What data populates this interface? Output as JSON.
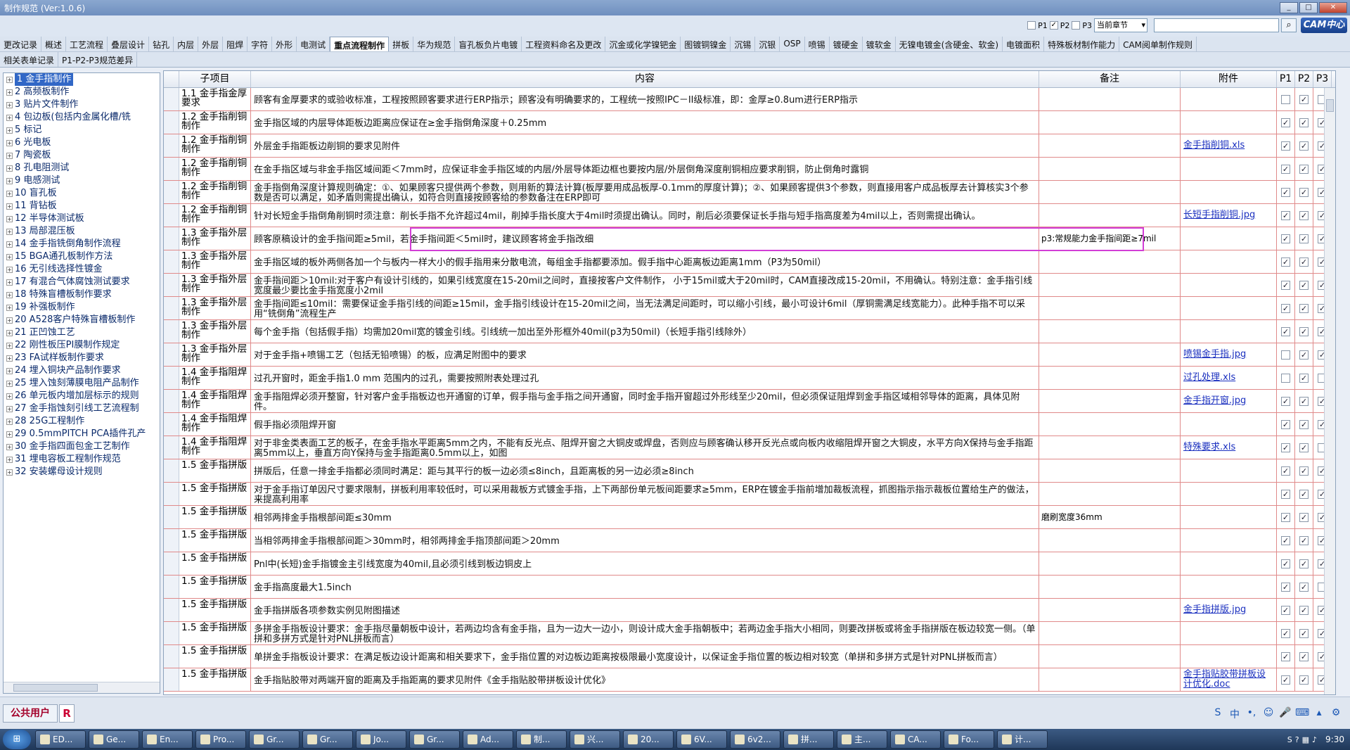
{
  "window": {
    "title": "制作规范 (Ver:1.0.6)"
  },
  "toolbar": {
    "filters": [
      {
        "label": "P1",
        "checked": false
      },
      {
        "label": "P2",
        "checked": true
      },
      {
        "label": "P3",
        "checked": false
      }
    ],
    "chapter_select": "当前章节",
    "logo": "CAM中心"
  },
  "tabs_row1": [
    "更改记录",
    "概述",
    "工艺流程",
    "叠层设计",
    "钻孔",
    "内层",
    "外层",
    "阻焊",
    "字符",
    "外形",
    "电测试",
    "重点流程制作",
    "拼板",
    "华为规范",
    "盲孔板负片电镀",
    "工程资料命名及更改",
    "沉金或化学镍钯金",
    "图镀铜镍金",
    "沉锡",
    "沉银",
    "OSP",
    "喷锡",
    "镀硬金",
    "镀软金",
    "无镍电镀金(含硬金、软金)",
    "电镀面积",
    "特殊板材制作能力",
    "CAM阅单制作规则"
  ],
  "tabs_row2": [
    "相关表单记录",
    "P1-P2-P3规范差异"
  ],
  "active_tab_index": 11,
  "tree": [
    "1 金手指制作",
    "2 高频板制作",
    "3 贴片文件制作",
    "4 包边板(包括内金属化槽/铣",
    "5 标记",
    "6 光电板",
    "7 陶瓷板",
    "8 孔电阻测试",
    "9 电感测试",
    "10 盲孔板",
    "11 背钻板",
    "12 半导体测试板",
    "13 局部混压板",
    "14 金手指铣倒角制作流程",
    "15 BGA通孔板制作方法",
    "16 无引线选择性镀金",
    "17 有混合气体腐蚀测试要求",
    "18 特殊盲槽板制作要求",
    "19 补强板制作",
    "20 A528客户特殊盲槽板制作",
    "21 正凹蚀工艺",
    "22 刚性板压PI膜制作规定",
    "23 FA试样板制作要求",
    "24 埋入铜块产品制作要求",
    "25 埋入蚀刻薄膜电阻产品制作",
    "26 单元板内增加层标示的规则",
    "27 金手指蚀刻引线工艺流程制",
    "28 25G工程制作",
    "29 0.5mmPITCH PCA插件孔产",
    "30 金手指四面包金工艺制作",
    "31 埋电容板工程制作规范",
    "32 安装螺母设计规则"
  ],
  "grid": {
    "headers": {
      "sub": "子项目",
      "content": "内容",
      "note": "备注",
      "attachment": "附件",
      "p1": "P1",
      "p2": "P2",
      "p3": "P3"
    },
    "rows": [
      {
        "sub": "1.1 金手指金厚要求",
        "content": "顾客有金厚要求的或验收标准，工程按照顾客要求进行ERP指示；顾客没有明确要求的，工程统一按照IPC－II级标准，即：金厚≥0.8um进行ERP指示",
        "note": "",
        "att": "",
        "p": [
          false,
          true,
          false
        ]
      },
      {
        "sub": "1.2 金手指削铜制作",
        "content": "金手指区域的内层导体距板边距离应保证在≥金手指倒角深度＋0.25mm",
        "note": "",
        "att": "",
        "p": [
          true,
          true,
          true
        ]
      },
      {
        "sub": "1.2 金手指削铜制作",
        "content": "外层金手指距板边削铜的要求见附件",
        "note": "",
        "att": "金手指削铜.xls",
        "p": [
          true,
          true,
          true
        ]
      },
      {
        "sub": "1.2 金手指削铜制作",
        "content": "在金手指区域与非金手指区域间距＜7mm时，应保证非金手指区域的内层/外层导体距边框也要按内层/外层倒角深度削铜相应要求削铜，防止倒角时露铜",
        "note": "",
        "att": "",
        "p": [
          true,
          true,
          true
        ]
      },
      {
        "sub": "1.2 金手指削铜制作",
        "content": "金手指倒角深度计算规则确定：①、如果顾客只提供两个参数，则用新的算法计算(板厚要用成品板厚-0.1mm的厚度计算)；②、如果顾客提供3个参数，则直接用客户成品板厚去计算核实3个参数是否可以满足，如矛盾则需提出确认，如符合则直接按顾客给的参数备注在ERP即可",
        "note": "",
        "att": "",
        "p": [
          true,
          true,
          true
        ]
      },
      {
        "sub": "1.2 金手指削铜制作",
        "content": "针对长短金手指倒角削铜时须注意：削长手指不允许超过4mil，削掉手指长度大于4mil时须提出确认。同时，削后必须要保证长手指与短手指高度差为4mil以上，否则需提出确认。",
        "note": "",
        "att": "长短手指削铜.jpg",
        "p": [
          true,
          true,
          true
        ]
      },
      {
        "sub": "1.3 金手指外层制作",
        "content": "顾客原稿设计的金手指间距≥5mil，若金手指间距＜5mil时，建议顾客将金手指改细",
        "note": "p3:常规能力金手指间距≥7mil",
        "att": "",
        "p": [
          true,
          true,
          true
        ]
      },
      {
        "sub": "1.3 金手指外层制作",
        "content": "金手指区域的板外两侧各加一个与板内一样大小的假手指用来分散电流，每组金手指都要添加。假手指中心距离板边距离1mm（P3为50mil）",
        "note": "",
        "att": "",
        "p": [
          true,
          true,
          true
        ]
      },
      {
        "sub": "1.3 金手指外层制作",
        "content": "金手指间距＞10mil:对于客户有设计引线的，如果引线宽度在15-20mil之间时，直接按客户文件制作， 小于15mil或大于20mil时，CAM直接改成15-20mil，不用确认。特别注意：金手指引线宽度最少要比金手指宽度小2mil",
        "note": "",
        "att": "",
        "p": [
          true,
          true,
          true
        ]
      },
      {
        "sub": "1.3 金手指外层制作",
        "content": "金手指间距≤10mil：需要保证金手指引线的间距≥15mil，金手指引线设计在15-20mil之间，当无法满足间距时，可以缩小引线，最小可设计6mil（厚铜需满足线宽能力）。此种手指不可以采用“铣倒角”流程生产",
        "note": "",
        "att": "",
        "p": [
          true,
          true,
          true
        ]
      },
      {
        "sub": "1.3 金手指外层制作",
        "content": "每个金手指（包括假手指）均需加20mil宽的镀金引线。引线统一加出至外形框外40mil(p3为50mil)（长短手指引线除外）",
        "note": "",
        "att": "",
        "p": [
          true,
          true,
          true
        ]
      },
      {
        "sub": "1.3 金手指外层制作",
        "content": "对于金手指+喷锡工艺（包括无铅喷锡）的板，应满足附图中的要求",
        "note": "",
        "att": "喷锡金手指.jpg",
        "p": [
          false,
          true,
          true
        ]
      },
      {
        "sub": "1.4 金手指阻焊制作",
        "content": "过孔开窗时，距金手指1.0 mm 范围内的过孔，需要按照附表处理过孔",
        "note": "",
        "att": "过孔处理.xls",
        "p": [
          false,
          true,
          false
        ]
      },
      {
        "sub": "1.4 金手指阻焊制作",
        "content": "金手指阻焊必须开整窗，针对客户金手指板边也开通窗的订单，假手指与金手指之间开通窗，同时金手指开窗超过外形线至少20mil，但必须保证阻焊到金手指区域相邻导体的距离，具体见附件。",
        "note": "",
        "att": "金手指开窗.jpg",
        "p": [
          true,
          true,
          true
        ]
      },
      {
        "sub": "1.4 金手指阻焊制作",
        "content": "假手指必须阻焊开窗",
        "note": "",
        "att": "",
        "p": [
          true,
          true,
          true
        ]
      },
      {
        "sub": "1.4 金手指阻焊制作",
        "content": "对于非金类表面工艺的板子，在金手指水平距离5mm之内，不能有反光点、阻焊开窗之大铜皮或焊盘，否则应与顾客确认移开反光点或向板内收缩阻焊开窗之大铜皮，水平方向X保持与金手指距离5mm以上，垂直方向Y保持与金手指距离0.5mm以上，如图",
        "note": "",
        "att": "特殊要求.xls",
        "p": [
          true,
          true,
          false
        ]
      },
      {
        "sub": "1.5 金手指拼版",
        "content": "拼版后，任意一排金手指都必须同时满足：距与其平行的板一边必须≤8inch，且距离板的另一边必须≥8inch",
        "note": "",
        "att": "",
        "p": [
          true,
          true,
          true
        ]
      },
      {
        "sub": "1.5 金手指拼版",
        "content": "对于金手指订单因尺寸要求限制，拼板利用率较低时，可以采用裁板方式镀金手指，上下两部份单元板间距要求≥5mm，ERP在镀金手指前增加裁板流程，抓图指示指示裁板位置给生产的做法，来提高利用率",
        "note": "",
        "att": "",
        "p": [
          true,
          true,
          true
        ]
      },
      {
        "sub": "1.5 金手指拼版",
        "content": "相邻两排金手指根部间距≤30mm",
        "note": "磨刷宽度36mm",
        "att": "",
        "p": [
          true,
          true,
          true
        ]
      },
      {
        "sub": "1.5 金手指拼版",
        "content": "当相邻两排金手指根部间距＞30mm时，相邻两排金手指顶部间距＞20mm",
        "note": "",
        "att": "",
        "p": [
          true,
          true,
          true
        ]
      },
      {
        "sub": "1.5 金手指拼版",
        "content": "Pnl中(长短)金手指镀金主引线宽度为40mil,且必须引线到板边铜皮上",
        "note": "",
        "att": "",
        "p": [
          true,
          true,
          true
        ]
      },
      {
        "sub": "1.5 金手指拼版",
        "content": "金手指高度最大1.5inch",
        "note": "",
        "att": "",
        "p": [
          true,
          true,
          false
        ]
      },
      {
        "sub": "1.5 金手指拼版",
        "content": "金手指拼版各项参数实例见附图描述",
        "note": "",
        "att": "金手指拼版.jpg",
        "p": [
          true,
          true,
          true
        ]
      },
      {
        "sub": "1.5 金手指拼版",
        "content": "多拼金手指板设计要求：金手指尽量朝板中设计，若两边均含有金手指，且为一边大一边小，则设计成大金手指朝板中；若两边金手指大小相同，则要改拼板或将金手指拼版在板边较宽一侧。（单拼和多拼方式是针对PNL拼板而言）",
        "note": "",
        "att": "",
        "p": [
          true,
          true,
          true
        ]
      },
      {
        "sub": "1.5 金手指拼版",
        "content": "单拼金手指板设计要求：在满足板边设计距离和相关要求下，金手指位置的对边板边距离按极限最小宽度设计，以保证金手指位置的板边相对较宽（单拼和多拼方式是针对PNL拼板而言）",
        "note": "",
        "att": "",
        "p": [
          true,
          true,
          true
        ]
      },
      {
        "sub": "1.5 金手指拼版",
        "content": "金手指贴胶带对两端开窗的距离及手指距离的要求见附件《金手指贴胶带拼板设计优化》",
        "note": "",
        "att": "金手指贴胶带拼板设计优化.doc",
        "p": [
          true,
          true,
          true
        ]
      }
    ]
  },
  "statusbar": {
    "user": "公共用户",
    "role": "R"
  },
  "taskbar": {
    "start": "⊞",
    "tasks": [
      "ED...",
      "Ge...",
      "En...",
      "Pro...",
      "Gr...",
      "Gr...",
      "Jo...",
      "Gr...",
      "Ad...",
      "制...",
      "兴...",
      "20...",
      "6V...",
      "6v2...",
      "拼...",
      "主...",
      "CA...",
      "Fo...",
      "计..."
    ],
    "clock": "9:30"
  }
}
